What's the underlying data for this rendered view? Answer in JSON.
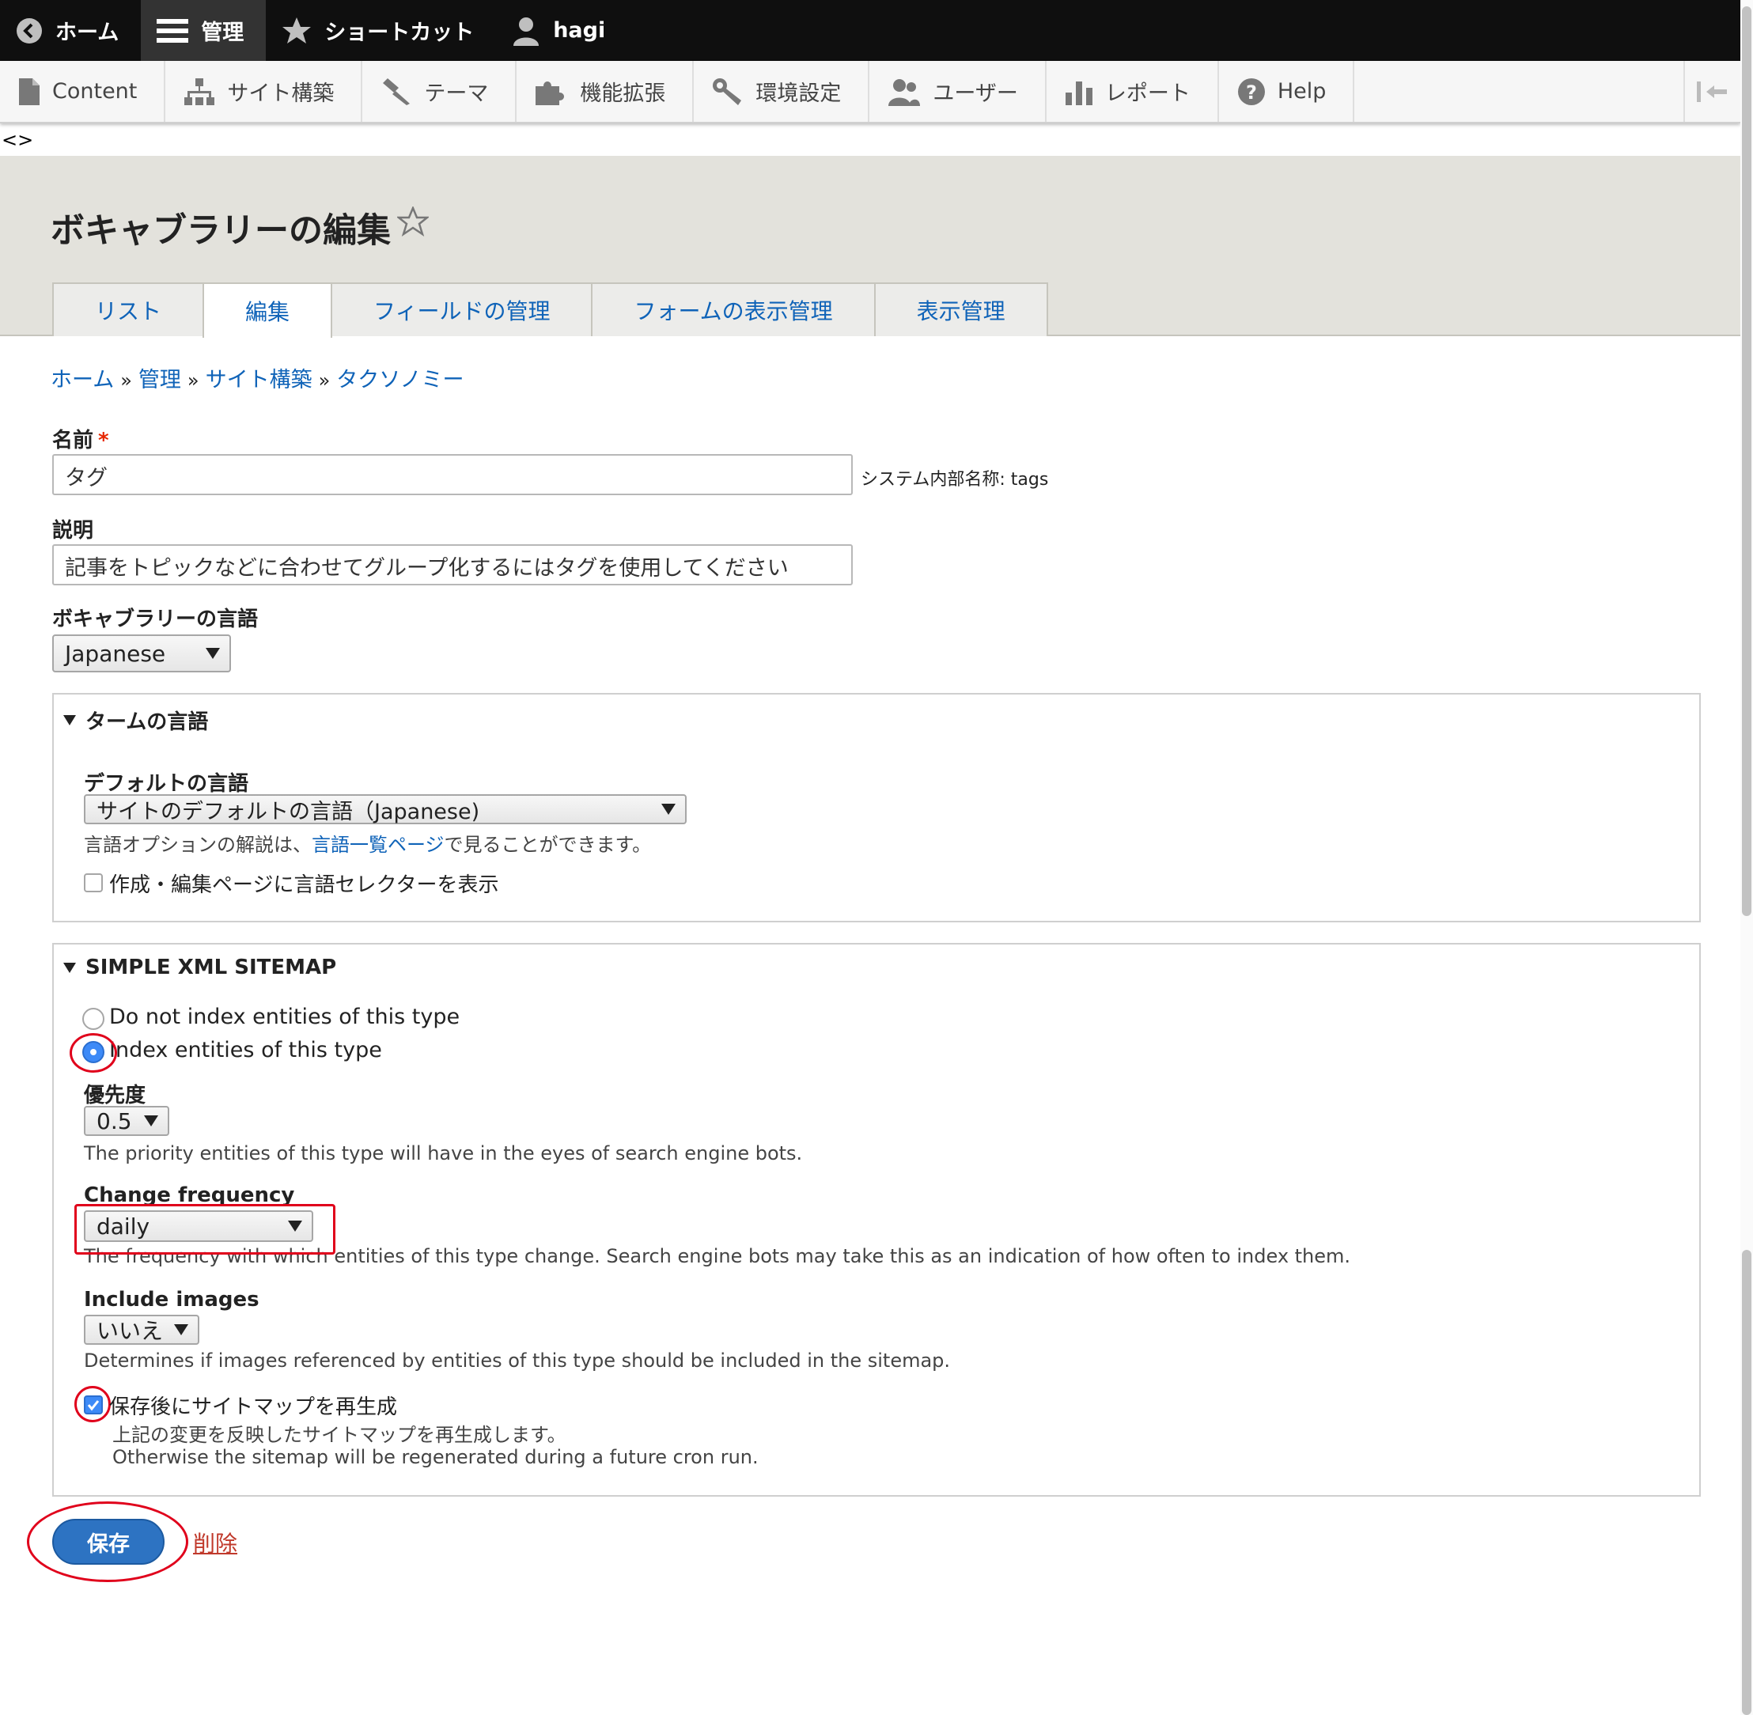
{
  "toolbar": {
    "home": "ホーム",
    "manage": "管理",
    "shortcuts": "ショートカット",
    "user": "hagi"
  },
  "tray": {
    "items": [
      "Content",
      "サイト構築",
      "テーマ",
      "機能拡張",
      "環境設定",
      "ユーザー",
      "レポート",
      "Help"
    ]
  },
  "stray_text": "<>",
  "page": {
    "title": "ボキャブラリーの編集",
    "tabs": [
      "リスト",
      "編集",
      "フィールドの管理",
      "フォームの表示管理",
      "表示管理"
    ]
  },
  "breadcrumb": [
    "ホーム",
    "管理",
    "サイト構築",
    "タクソノミー"
  ],
  "breadcrumb_sep": "»",
  "form": {
    "name_label": "名前",
    "required_mark": "*",
    "name_value": "タグ",
    "machine_name_label": "システム内部名称:",
    "machine_name_value": "tags",
    "description_label": "説明",
    "description_value": "記事をトピックなどに合わせてグループ化するにはタグを使用してください",
    "vocab_language_label": "ボキャブラリーの言語",
    "vocab_language_value": "Japanese"
  },
  "term_language": {
    "legend": "タームの言語",
    "default_language_label": "デフォルトの言語",
    "default_language_value": "サイトのデフォルトの言語（Japanese)",
    "help_prefix": "言語オプションの解説は、",
    "help_link": "言語一覧ページ",
    "help_suffix": "で見ることができます。",
    "show_selector_label": "作成・編集ページに言語セレクターを表示"
  },
  "sitemap": {
    "legend": "SIMPLE XML SITEMAP",
    "radio_no_index": "Do not index entities of this type",
    "radio_index": "Index entities of this type",
    "priority_label": "優先度",
    "priority_value": "0.5",
    "priority_desc": "The priority entities of this type will have in the eyes of search engine bots.",
    "changefreq_label": "Change frequency",
    "changefreq_value": "daily",
    "changefreq_desc": "The frequency with which entities of this type change. Search engine bots may take this as an indication of how often to index them.",
    "images_label": "Include images",
    "images_value": "いいえ",
    "images_desc": "Determines if images referenced by entities of this type should be included in the sitemap.",
    "regen_label": "保存後にサイトマップを再生成",
    "regen_desc_1": "上記の変更を反映したサイトマップを再生成します。",
    "regen_desc_2": "Otherwise the sitemap will be regenerated during a future cron run."
  },
  "actions": {
    "save": "保存",
    "delete": "削除"
  },
  "colors": {
    "toolbar_bg": "#0f0f0f",
    "link": "#0f63b8",
    "primary_button": "#2d73c2",
    "annotation": "#e0001b"
  }
}
